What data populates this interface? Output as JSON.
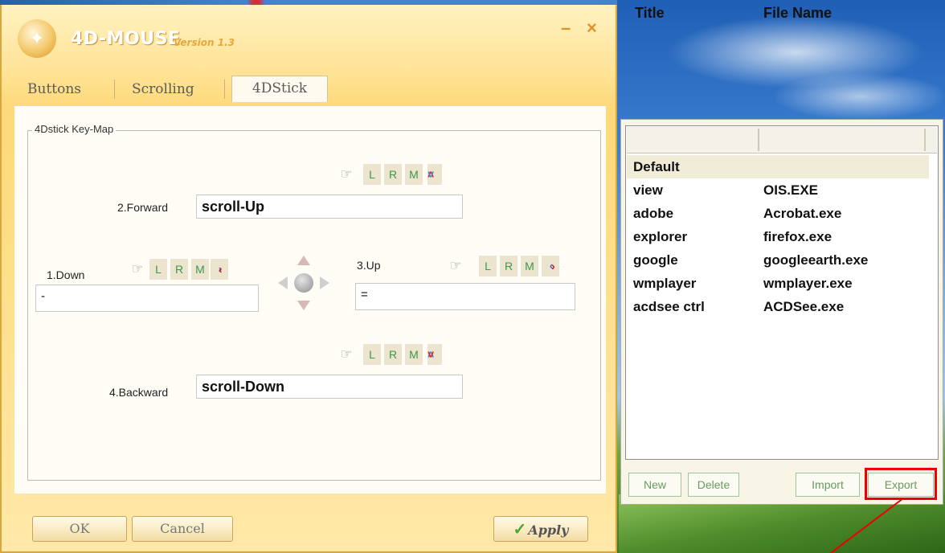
{
  "app": {
    "name": "4D-MOUSE",
    "version": "Version 1.3",
    "minimize_symbol": "–",
    "close_symbol": "×"
  },
  "tabs": [
    {
      "label": "Buttons",
      "active": false
    },
    {
      "label": "Scrolling",
      "active": false
    },
    {
      "label": "4DStick",
      "active": true
    }
  ],
  "keymap": {
    "group_label": "4Dstick Key-Map",
    "forward": {
      "label": "2.Forward",
      "value": "scroll-Up"
    },
    "down": {
      "label": "1.Down",
      "value": "-"
    },
    "up": {
      "label": "3.Up",
      "value": "="
    },
    "backward": {
      "label": "4.Backward",
      "value": "scroll-Down"
    },
    "button_letters": {
      "l": "L",
      "r": "R",
      "m": "M"
    }
  },
  "dialog_buttons": {
    "ok": "OK",
    "cancel": "Cancel",
    "apply": "Apply"
  },
  "profiles": {
    "columns": [
      "Title",
      "File Name"
    ],
    "rows": [
      {
        "title": "Default",
        "file": ""
      },
      {
        "title": "view",
        "file": "OIS.EXE"
      },
      {
        "title": "adobe",
        "file": "Acrobat.exe"
      },
      {
        "title": "explorer",
        "file": "firefox.exe"
      },
      {
        "title": "google",
        "file": "googleearth.exe"
      },
      {
        "title": "wmplayer",
        "file": "wmplayer.exe"
      },
      {
        "title": "acdsee ctrl",
        "file": "ACDSee.exe"
      }
    ],
    "selected_index": 0,
    "buttons": {
      "new": "New",
      "delete": "Delete",
      "import": "Import",
      "export": "Export"
    }
  },
  "colors": {
    "highlight": "#e00000",
    "accent_green": "#3a9a4a",
    "window_gold": "#ffd979"
  }
}
